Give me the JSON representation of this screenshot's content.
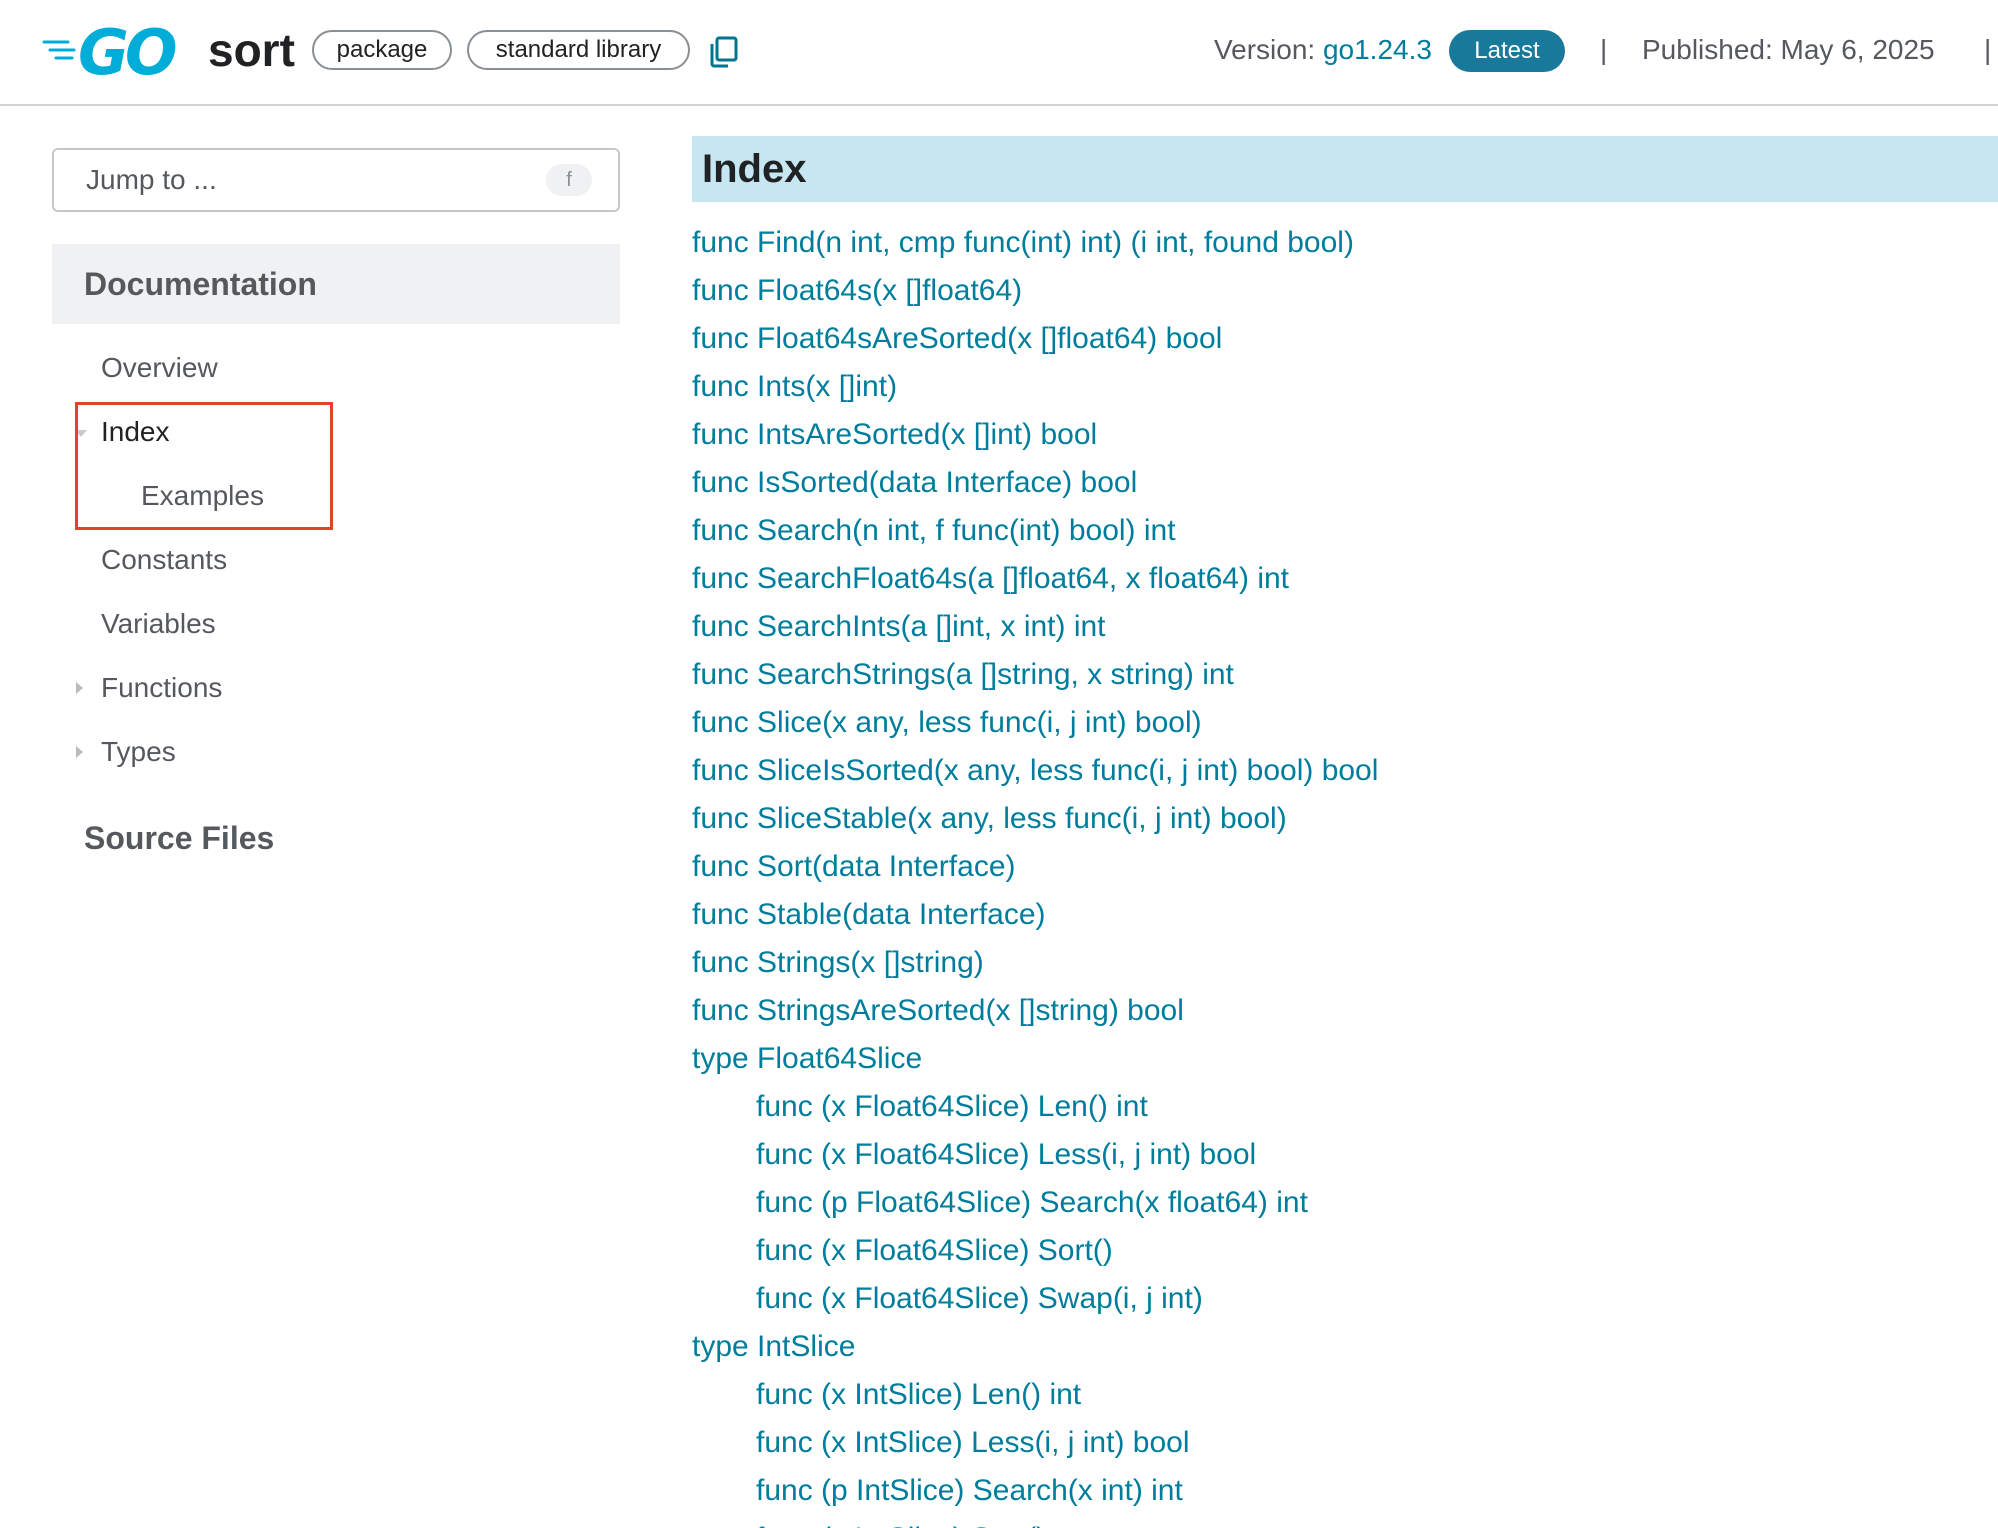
{
  "header": {
    "package_name": "sort",
    "chips": [
      "package",
      "standard library"
    ],
    "version_label": "Version: ",
    "version_value": "go1.24.3",
    "latest_badge": "Latest",
    "separator": "|",
    "published": "Published: May 6, 2025",
    "brand_color": "#00add8"
  },
  "sidebar": {
    "jump_placeholder": "Jump to ...",
    "jump_shortcut": "f",
    "documentation_header": "Documentation",
    "nav": [
      {
        "label": "Overview",
        "expandable": false
      },
      {
        "label": "Index",
        "expandable": true,
        "expanded": true,
        "active": true
      },
      {
        "label": "Examples",
        "expandable": false
      },
      {
        "label": "Constants",
        "expandable": false
      },
      {
        "label": "Variables",
        "expandable": false
      },
      {
        "label": "Functions",
        "expandable": true,
        "expanded": false
      },
      {
        "label": "Types",
        "expandable": true,
        "expanded": false
      }
    ],
    "source_files": "Source Files",
    "highlight_color": "#e2412c"
  },
  "main": {
    "index_title": "Index",
    "banner_color": "#c6e6f2",
    "link_color": "#007d9c",
    "items": [
      "func Find(n int, cmp func(int) int) (i int, found bool)",
      "func Float64s(x []float64)",
      "func Float64sAreSorted(x []float64) bool",
      "func Ints(x []int)",
      "func IntsAreSorted(x []int) bool",
      "func IsSorted(data Interface) bool",
      "func Search(n int, f func(int) bool) int",
      "func SearchFloat64s(a []float64, x float64) int",
      "func SearchInts(a []int, x int) int",
      "func SearchStrings(a []string, x string) int",
      "func Slice(x any, less func(i, j int) bool)",
      "func SliceIsSorted(x any, less func(i, j int) bool) bool",
      "func SliceStable(x any, less func(i, j int) bool)",
      "func Sort(data Interface)",
      "func Stable(data Interface)",
      "func Strings(x []string)",
      "func StringsAreSorted(x []string) bool",
      "type Float64Slice",
      "func (x Float64Slice) Len() int",
      "func (x Float64Slice) Less(i, j int) bool",
      "func (p Float64Slice) Search(x float64) int",
      "func (x Float64Slice) Sort()",
      "func (x Float64Slice) Swap(i, j int)",
      "type IntSlice",
      "func (x IntSlice) Len() int",
      "func (x IntSlice) Less(i, j int) bool",
      "func (p IntSlice) Search(x int) int",
      "func (x IntSlice) Sort()"
    ]
  }
}
